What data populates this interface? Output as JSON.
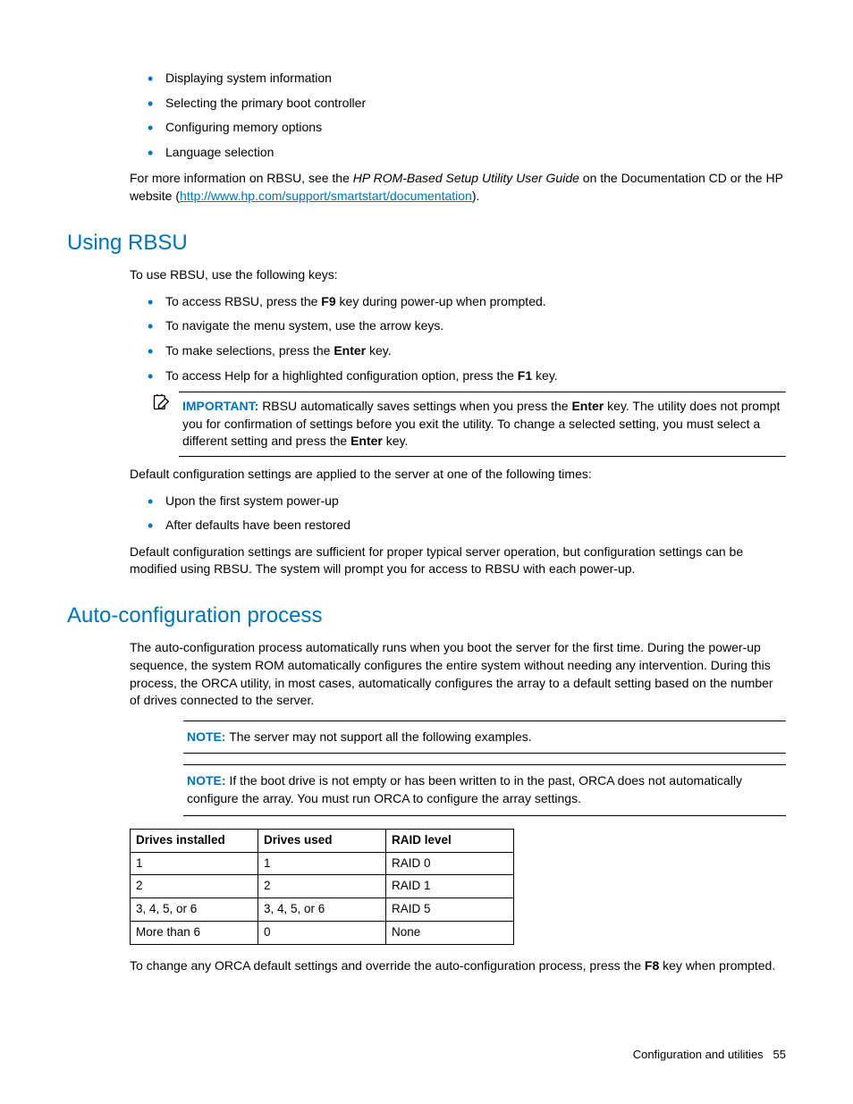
{
  "top_bullets": [
    "Displaying system information",
    "Selecting the primary boot controller",
    "Configuring memory options",
    "Language selection"
  ],
  "more_info_pre": "For more information on RBSU, see the ",
  "more_info_italic": "HP ROM-Based Setup Utility User Guide",
  "more_info_mid": " on the Documentation CD or the HP website (",
  "more_info_link": "http://www.hp.com/support/smartstart/documentation",
  "more_info_post": ").",
  "heading_using": "Using RBSU",
  "using_intro": "To use RBSU, use the following keys:",
  "using_bullets": {
    "b0_pre": "To access RBSU, press the ",
    "b0_bold": "F9",
    "b0_post": " key during power-up when prompted.",
    "b1": "To navigate the menu system, use the arrow keys.",
    "b2_pre": "To make selections, press the ",
    "b2_bold": "Enter",
    "b2_post": " key.",
    "b3_pre": "To access Help for a highlighted configuration option, press the ",
    "b3_bold": "F1",
    "b3_post": " key."
  },
  "important_label": "IMPORTANT:",
  "important_t1": "RBSU automatically saves settings when you press the ",
  "important_b1": "Enter",
  "important_t2": " key. The utility does not prompt you for confirmation of settings before you exit the utility. To change a selected setting, you must select a different setting and press the ",
  "important_b2": "Enter",
  "important_t3": " key.",
  "default_applied": "Default configuration settings are applied to the server at one of the following times:",
  "default_bullets": [
    "Upon the first system power-up",
    "After defaults have been restored"
  ],
  "default_sufficient": "Default configuration settings are sufficient for proper typical server operation, but configuration settings can be modified using RBSU. The system will prompt you for access to RBSU with each power-up.",
  "heading_auto": "Auto-configuration process",
  "auto_intro": "The auto-configuration process automatically runs when you boot the server for the first time. During the power-up sequence, the system ROM automatically configures the entire system without needing any intervention. During this process, the ORCA utility, in most cases, automatically configures the array to a default setting based on the number of drives connected to the server.",
  "note_label": "NOTE:",
  "note1": "The server may not support all the following examples.",
  "note2": "If the boot drive is not empty or has been written to in the past, ORCA does not automatically configure the array. You must run ORCA to configure the array settings.",
  "table": {
    "headers": [
      "Drives installed",
      "Drives used",
      "RAID level"
    ],
    "rows": [
      [
        "1",
        "1",
        "RAID 0"
      ],
      [
        "2",
        "2",
        "RAID 1"
      ],
      [
        "3, 4, 5, or 6",
        "3, 4, 5, or 6",
        "RAID 5"
      ],
      [
        "More than 6",
        "0",
        "None"
      ]
    ]
  },
  "orca_change_pre": "To change any ORCA default settings and override the auto-configuration process, press the ",
  "orca_change_bold": "F8",
  "orca_change_post": " key when prompted.",
  "footer_section": "Configuration and utilities",
  "footer_page": "55"
}
